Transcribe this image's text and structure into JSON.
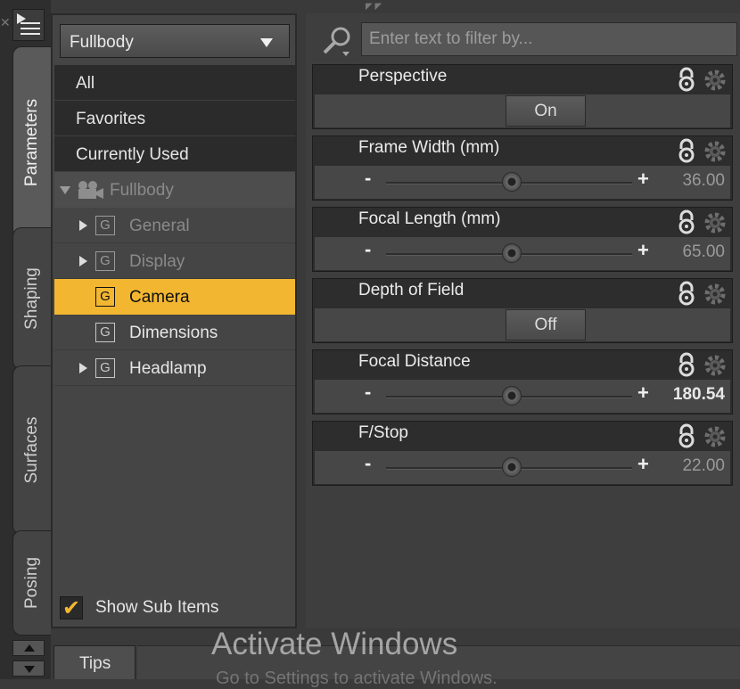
{
  "tabs": [
    {
      "label": "Parameters",
      "active": true
    },
    {
      "label": "Shaping",
      "active": false
    },
    {
      "label": "Surfaces",
      "active": false
    },
    {
      "label": "Posing",
      "active": false
    }
  ],
  "dropdown": {
    "selected": "Fullbody"
  },
  "tree": {
    "all": "All",
    "favorites": "Favorites",
    "currently_used": "Currently Used",
    "root": "Fullbody",
    "nodes": [
      {
        "label": "General",
        "icon": "G",
        "expandable": true,
        "muted": true
      },
      {
        "label": "Display",
        "icon": "G",
        "expandable": true,
        "muted": true
      },
      {
        "label": "Camera",
        "icon": "G",
        "expandable": false,
        "selected": true
      },
      {
        "label": "Dimensions",
        "icon": "G",
        "expandable": false
      },
      {
        "label": "Headlamp",
        "icon": "G",
        "expandable": true
      }
    ]
  },
  "show_sub_items": {
    "label": "Show Sub Items",
    "checked": true
  },
  "filter": {
    "placeholder": "Enter text to filter by..."
  },
  "params": [
    {
      "title": "Perspective",
      "type": "toggle",
      "state": "On"
    },
    {
      "title": "Frame Width (mm)",
      "type": "slider",
      "value": "36.00"
    },
    {
      "title": "Focal Length (mm)",
      "type": "slider",
      "value": "65.00"
    },
    {
      "title": "Depth of Field",
      "type": "toggle",
      "state": "Off"
    },
    {
      "title": "Focal Distance",
      "type": "slider",
      "value": "180.54"
    },
    {
      "title": "F/Stop",
      "type": "slider",
      "value": "22.00"
    }
  ],
  "slider_labels": {
    "minus": "-",
    "plus": "+"
  },
  "bottom": {
    "tips": "Tips"
  },
  "watermark": {
    "title": "Activate Windows",
    "subtitle": "Go to Settings to activate Windows."
  },
  "colors": {
    "accent": "#f2b631",
    "panel": "#454545",
    "dark_row": "#2b2b2b"
  }
}
